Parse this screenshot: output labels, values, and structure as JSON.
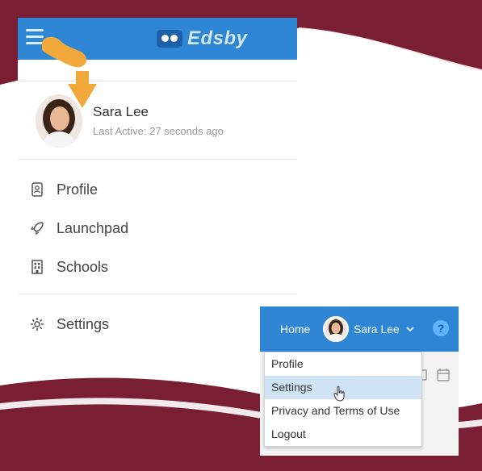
{
  "app": {
    "logo_text": "Edsby"
  },
  "mobile_menu": {
    "user": {
      "name": "Sara Lee",
      "last_active": "Last Active: 27 seconds ago"
    },
    "items": [
      {
        "label": "Profile",
        "icon": "profile-icon"
      },
      {
        "label": "Launchpad",
        "icon": "rocket-icon"
      },
      {
        "label": "Schools",
        "icon": "school-icon"
      },
      {
        "label": "Settings",
        "icon": "gear-icon"
      }
    ]
  },
  "desktop_header": {
    "home_label": "Home",
    "user_name": "Sara Lee",
    "help_label": "?"
  },
  "dropdown": {
    "items": [
      {
        "label": "Profile"
      },
      {
        "label": "Settings",
        "highlighted": true
      },
      {
        "label": "Privacy and Terms of Use"
      },
      {
        "label": "Logout"
      }
    ]
  },
  "colors": {
    "header_blue": "#2e86d4",
    "maroon": "#7a1f33",
    "pointer_orange": "#f2a93b",
    "highlight": "#cfe3f5"
  }
}
